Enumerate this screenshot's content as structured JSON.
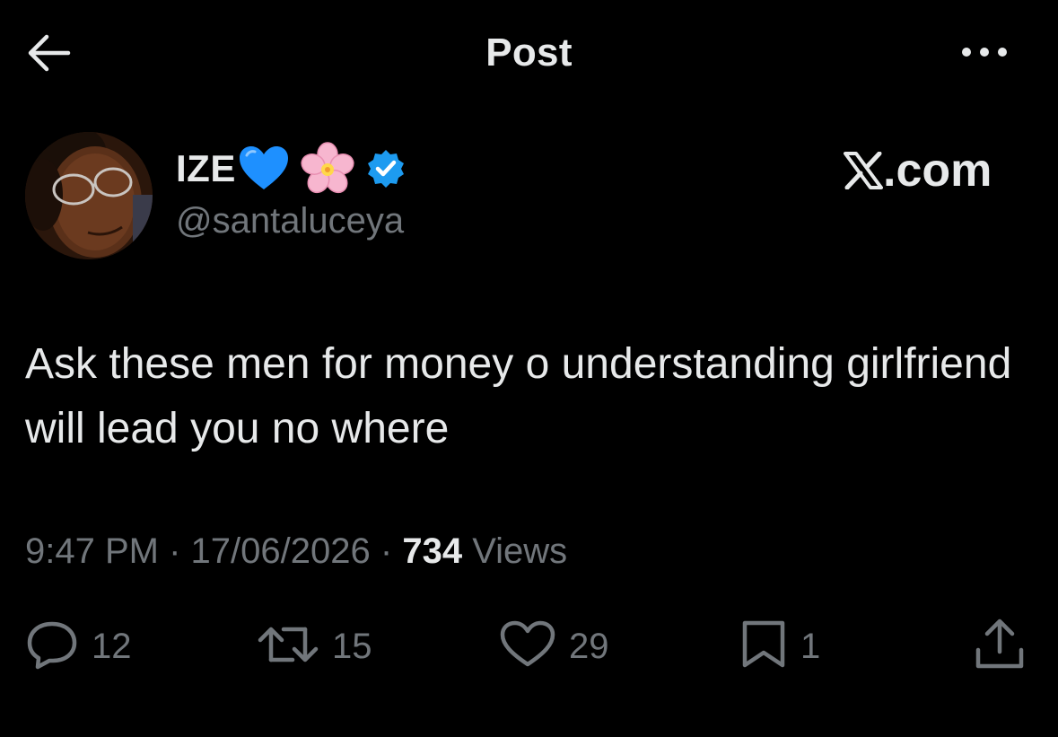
{
  "header": {
    "title": "Post",
    "back_icon": "arrow-left-icon",
    "more_icon": "more-dots-icon"
  },
  "author": {
    "display_name": "IZE",
    "emojis": [
      "blue-heart",
      "cherry-blossom"
    ],
    "verified": true,
    "handle": "@santaluceya",
    "watermark": "X.com"
  },
  "post": {
    "text": "Ask these men for money o understanding girlfriend will lead you no where"
  },
  "meta": {
    "time": "9:47 PM",
    "date": "17/06/2026",
    "views_count": "734",
    "views_label": "Views",
    "separator": "·"
  },
  "actions": {
    "replies": "12",
    "reposts": "15",
    "likes": "29",
    "bookmarks": "1"
  },
  "colors": {
    "background": "#000000",
    "primary_text": "#e7e9ea",
    "secondary_text": "#71767b",
    "verified_badge": "#1d9bf0",
    "heart": "#1e90ff"
  }
}
